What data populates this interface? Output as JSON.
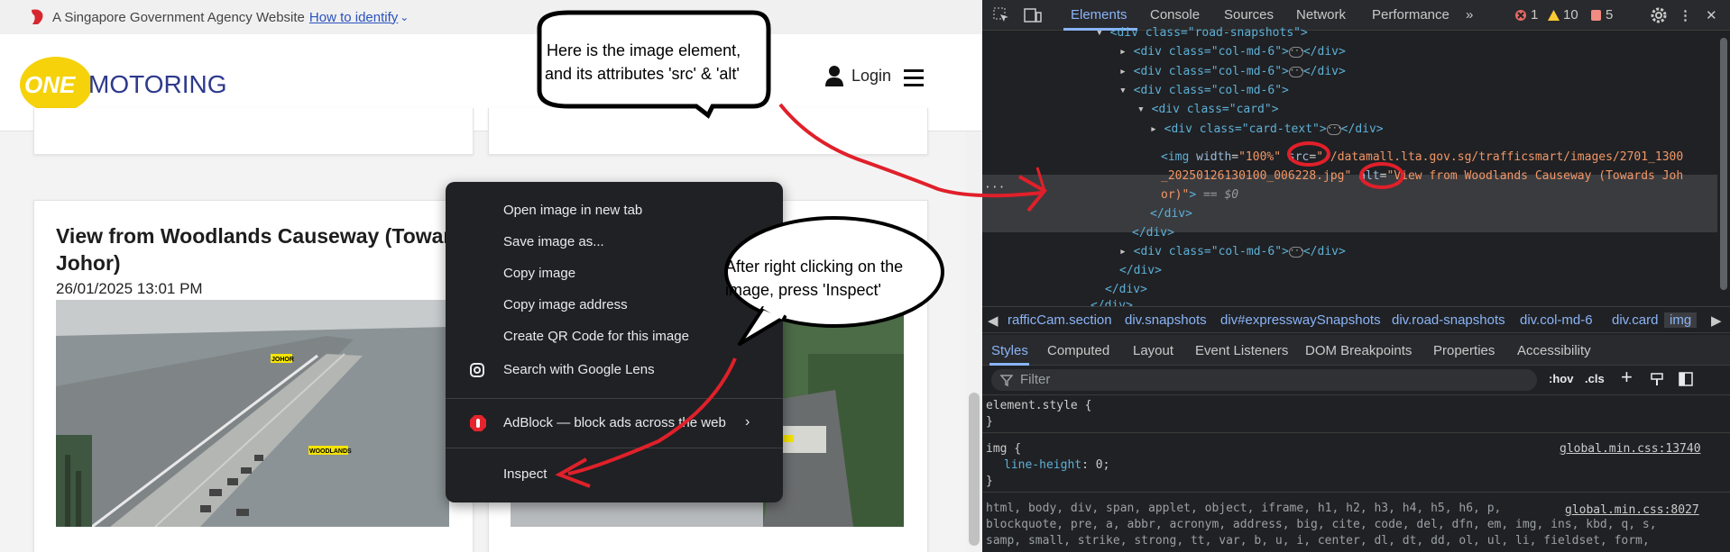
{
  "gov_banner": {
    "text": "A Singapore Government Agency Website",
    "link": "How to identify"
  },
  "header": {
    "logo_one": "ONE",
    "logo_motoring": "MOTORING",
    "login": "Login"
  },
  "card": {
    "title": "View from Woodlands Causeway (Towards Johor)",
    "date": "26/01/2025 13:01 PM",
    "cam_labels": {
      "johor": "JOHOR",
      "woodlands": "WOODLANDS"
    }
  },
  "context_menu": {
    "items": [
      "Open image in new tab",
      "Save image as...",
      "Copy image",
      "Copy image address",
      "Create QR Code for this image",
      "Search with Google Lens",
      "AdBlock — block ads across the web",
      "Inspect"
    ]
  },
  "annotations": {
    "top_bubble": [
      "Here is the image element,",
      "and its attributes 'src' & 'alt'"
    ],
    "mid_bubble": [
      "After right clicking on the",
      "image, press 'Inspect'"
    ]
  },
  "devtools": {
    "tabs": [
      "Elements",
      "Console",
      "Sources",
      "Network",
      "Performance"
    ],
    "badges": {
      "errors": "1",
      "warnings": "10",
      "info": "5"
    },
    "dom": {
      "road_snapshots": "<div class=\"road-snapshots\">",
      "col1": "<div class=\"col-md-6\">",
      "col2": "<div class=\"col-md-6\">",
      "col3": "<div class=\"col-md-6\">",
      "card": "<div class=\"card\">",
      "card_text": "<div class=\"card-text\">",
      "img_width_attr": "width",
      "img_width_val": "\"100%\"",
      "img_src_attr": "src",
      "img_src_val": "\"//datamall.lta.gov.sg/trafficsmart/images/2701_1300",
      "img_src_val2": "_20250126130100_006228.jpg\"",
      "img_alt_attr": "alt",
      "img_alt_val": "\"View from Woodlands Causeway (Towards Joh",
      "img_alt_val2": "or)\"",
      "img_eq": "== $0",
      "close_div1": "</div>",
      "close_div2": "</div>",
      "col4": "<div class=\"col-md-6\">",
      "close_div3": "</div>",
      "close_div4": "</div>",
      "close_div5": "</div>"
    },
    "breadcrumbs": [
      "rafficCam.section",
      "div.snapshots",
      "div#expresswaySnapshots",
      "div.road-snapshots",
      "div.col-md-6",
      "div.card",
      "img"
    ],
    "subtabs": [
      "Styles",
      "Computed",
      "Layout",
      "Event Listeners",
      "DOM Breakpoints",
      "Properties",
      "Accessibility"
    ],
    "filter_placeholder": "Filter",
    "filter_tools": [
      ":hov",
      ".cls"
    ],
    "styles": {
      "element_style": "element.style {",
      "brace_close": "}",
      "img_rule": "img {",
      "line_height_prop": "line-height",
      "line_height_val": "0;",
      "src1": "global.min.css:13740",
      "src2": "global.min.css:8027",
      "reset1": "html, body, div, span, applet, object, iframe, h1, h2, h3, h4, h5, h6, p,",
      "reset2": "blockquote, pre, a, abbr, acronym, address, big, cite, code, del, dfn, em, img, ins, kbd, q, s,",
      "reset3": "samp, small, strike, strong, tt, var, b, u, i, center, dl, dt, dd, ol, ul, li, fieldset, form,"
    }
  },
  "colors": {
    "accent": "#8ab4f8",
    "annotation": "#e0202a",
    "logo_yellow": "#f5d20a",
    "logo_navy": "#2e3a8c"
  }
}
